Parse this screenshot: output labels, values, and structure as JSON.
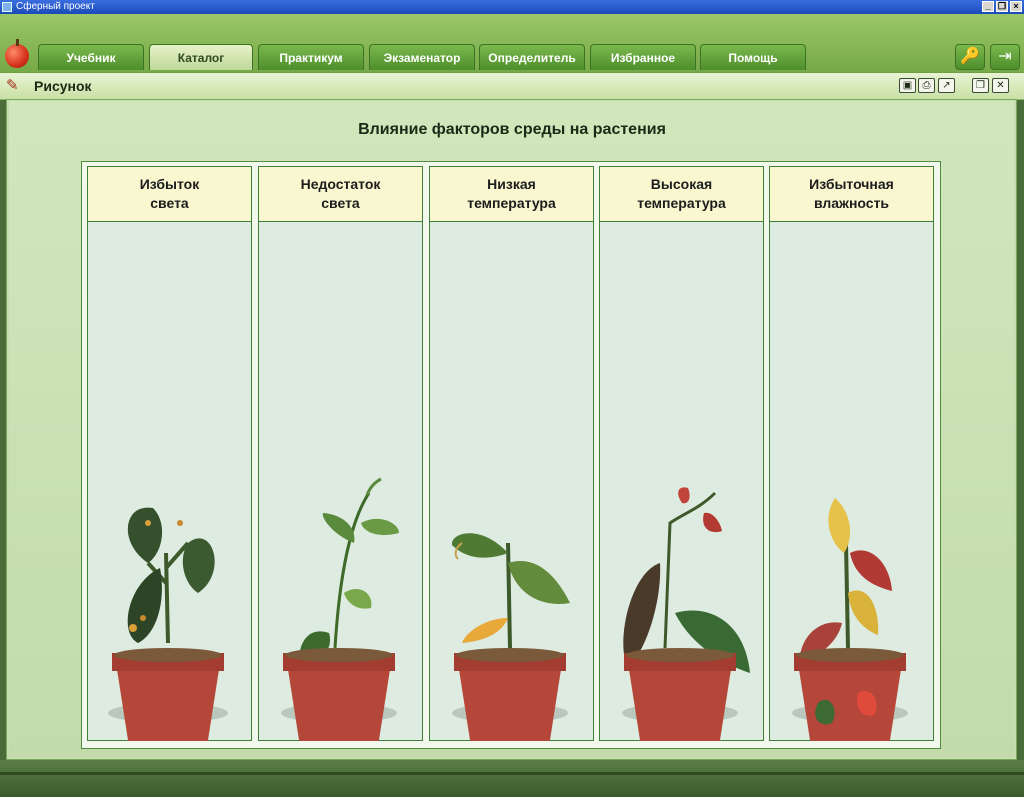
{
  "window": {
    "title": "Сферный проект"
  },
  "tabs": [
    "Учебник",
    "Каталог",
    "Практикум",
    "Экзаменатор",
    "Определитель",
    "Избранное",
    "Помощь"
  ],
  "active_tab": "Каталог",
  "toolbar_icons": {
    "key": "key-icon",
    "exit": "exit-icon",
    "logo": "apple-icon"
  },
  "panel": {
    "title": "Рисунок",
    "buttons": [
      "save-icon",
      "print-icon",
      "export-icon",
      "restore-icon",
      "close-icon"
    ]
  },
  "figure": {
    "title": "Влияние факторов среды на растения",
    "columns": [
      {
        "label": "Избыток\nсвета",
        "illustration": "plant-spotted-leaves"
      },
      {
        "label": "Недостаток\nсвета",
        "illustration": "plant-elongated-stem"
      },
      {
        "label": "Низкая\nтемпература",
        "illustration": "plant-wilted-leaves"
      },
      {
        "label": "Высокая\nтемпература",
        "illustration": "plant-dried-leaves"
      },
      {
        "label": "Избыточная\nвлажность",
        "illustration": "plant-yellowed-leaves"
      }
    ]
  },
  "colors": {
    "accent_green": "#5a9a33",
    "header_cream": "#f8f7d0",
    "pot": "#b4473a"
  }
}
